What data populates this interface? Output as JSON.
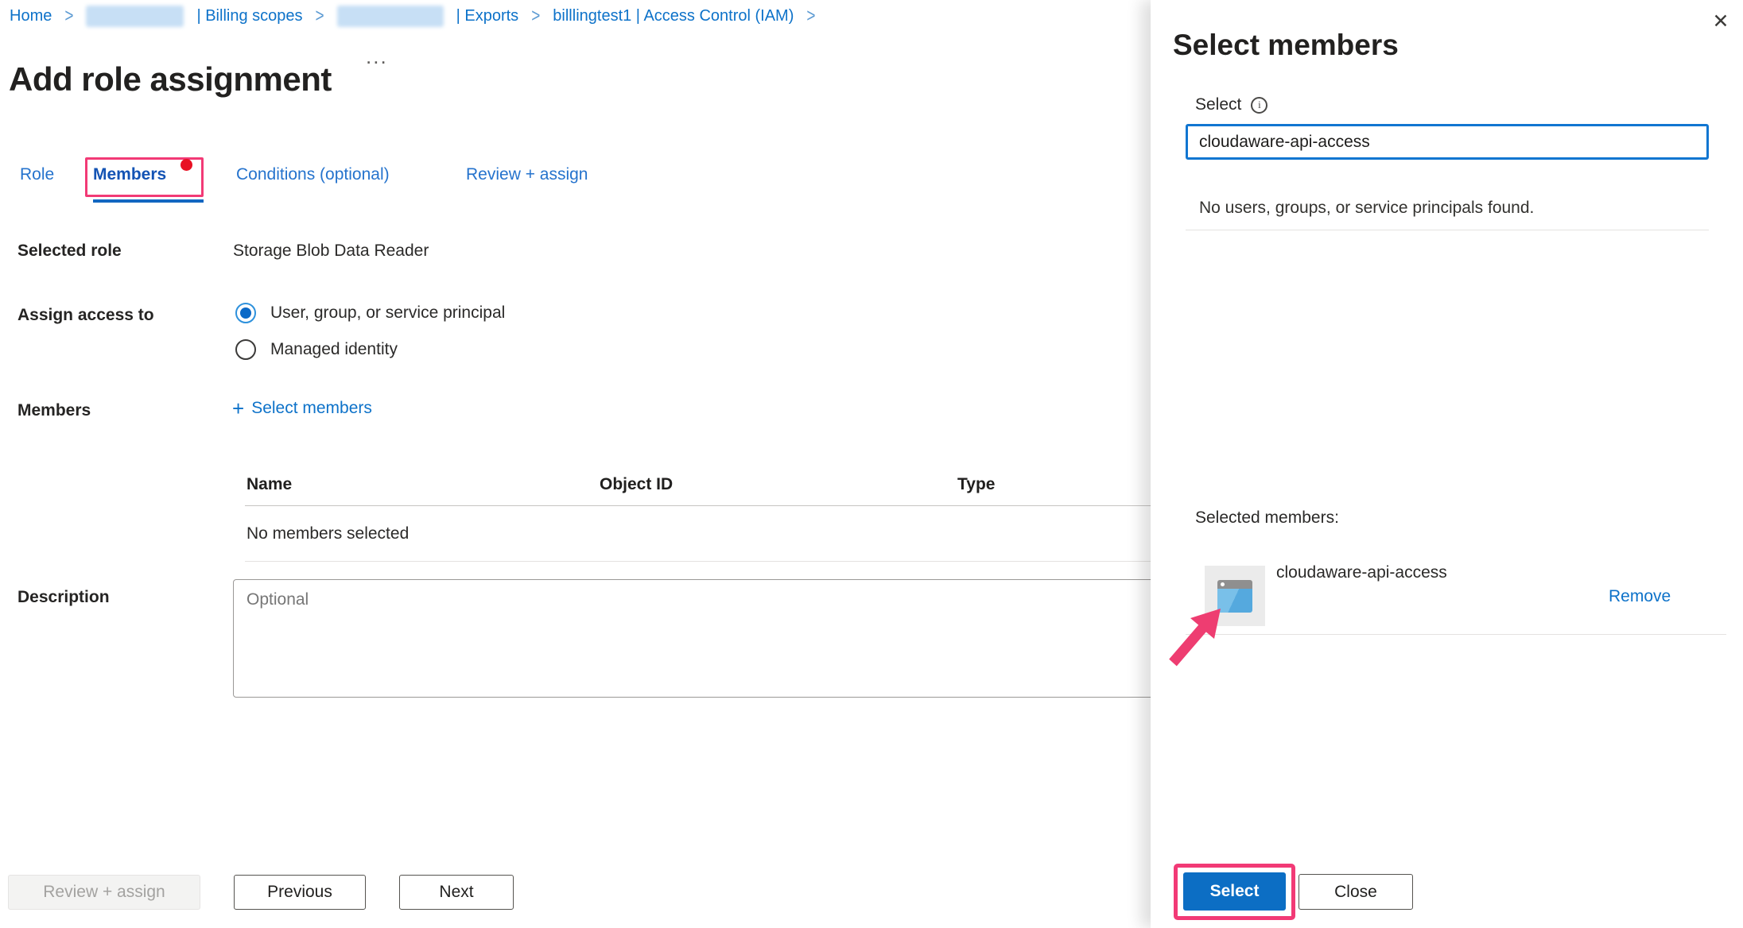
{
  "colors": {
    "accent": "#0c6ec4",
    "link": "#0d72c9",
    "annotation_pink": "#f23a76",
    "arrow_pink": "#ee3d71",
    "notification_red": "#e81123"
  },
  "breadcrumb": {
    "separator": ">",
    "home": "Home",
    "billing_scopes": "| Billing scopes",
    "exports": "| Exports",
    "iam": "billlingtest1 | Access Control (IAM)"
  },
  "page": {
    "title": "Add role assignment",
    "more": "..."
  },
  "tabs": {
    "role": "Role",
    "members": "Members",
    "conditions": "Conditions (optional)",
    "review": "Review + assign"
  },
  "form": {
    "selected_role_label": "Selected role",
    "selected_role_value": "Storage Blob Data Reader",
    "assign_access_label": "Assign access to",
    "radio_user_label": "User, group, or service principal",
    "radio_managed_label": "Managed identity",
    "members_label": "Members",
    "select_members_plus": "+",
    "select_members_link": "Select members",
    "table": {
      "headers": [
        "Name",
        "Object ID",
        "Type"
      ],
      "empty_text": "No members selected"
    },
    "description_label": "Description",
    "description_placeholder": "Optional"
  },
  "footer": {
    "review_assign": "Review + assign",
    "previous": "Previous",
    "next": "Next"
  },
  "panel": {
    "title": "Select members",
    "close_icon": "✕",
    "select_label": "Select",
    "info_icon": "i",
    "search_value": "cloudaware-api-access",
    "no_results": "No users, groups, or service principals found.",
    "selected_members_label": "Selected members:",
    "member": {
      "name": "cloudaware-api-access",
      "remove": "Remove"
    },
    "select_button": "Select",
    "close_button": "Close"
  }
}
